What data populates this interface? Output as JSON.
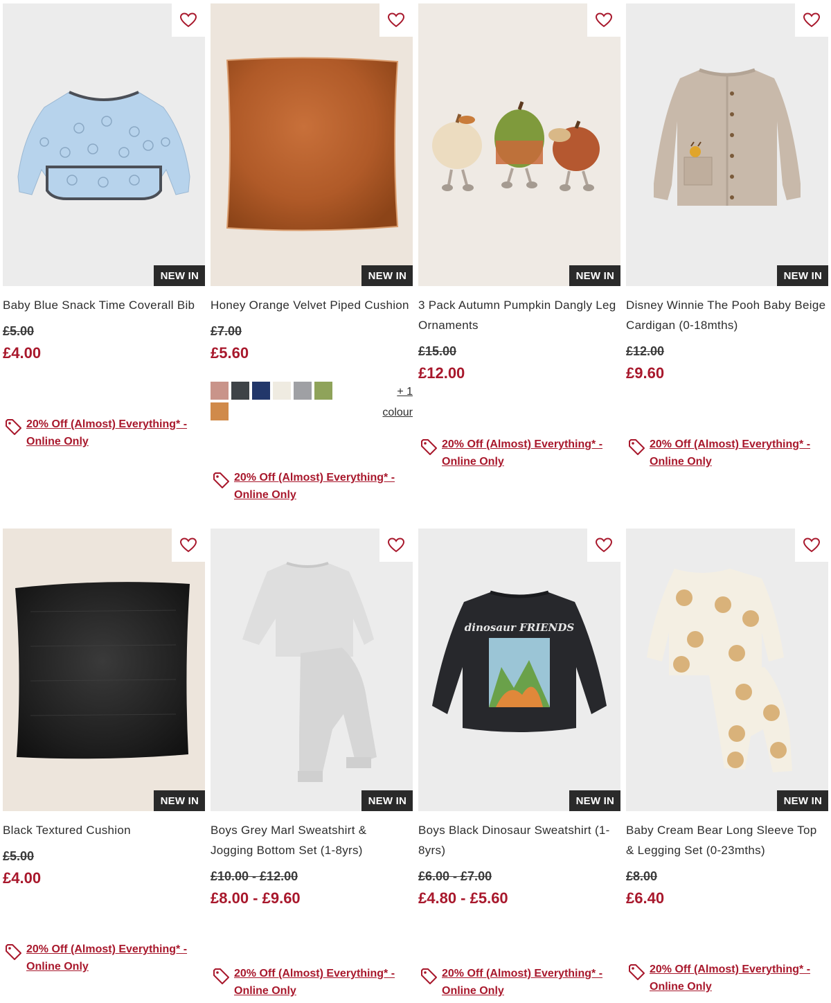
{
  "colors": {
    "sale": "#a8182c",
    "badge": "#2a2a2a"
  },
  "badge_label": "NEW IN",
  "promo_label": "20% Off (Almost) Everything* - Online Only",
  "products": [
    {
      "title": "Baby Blue Snack Time Coverall Bib",
      "was": "£5.00",
      "now": "£4.00",
      "image": "blue-coverall-bib"
    },
    {
      "title": "Honey Orange Velvet Piped Cushion",
      "was": "£7.00",
      "now": "£5.60",
      "image": "orange-velvet-cushion",
      "swatches": [
        "#c9948a",
        "#3e4347",
        "#22376a",
        "#efebe1",
        "#9fa0a4",
        "#8fa35a",
        "#d08a4a"
      ],
      "more_colours": "+ 1 colour"
    },
    {
      "title": "3 Pack Autumn Pumpkin Dangly Leg Ornaments",
      "was": "£15.00",
      "now": "£12.00",
      "image": "pumpkin-ornaments"
    },
    {
      "title": "Disney Winnie The Pooh Baby Beige Cardigan (0-18mths)",
      "was": "£12.00",
      "now": "£9.60",
      "image": "beige-cardigan"
    },
    {
      "title": "Black Textured Cushion",
      "was": "£5.00",
      "now": "£4.00",
      "image": "black-cushion"
    },
    {
      "title": "Boys Grey Marl Sweatshirt & Jogging Bottom Set (1-8yrs)",
      "was": "£10.00 - £12.00",
      "now": "£8.00 - £9.60",
      "image": "grey-marl-set"
    },
    {
      "title": "Boys Black Dinosaur Sweatshirt (1-8yrs)",
      "was": "£6.00 - £7.00",
      "now": "£4.80 - £5.60",
      "image": "black-dinosaur-sweatshirt",
      "print_text": "dinosaur FRIENDS"
    },
    {
      "title": "Baby Cream Bear Long Sleeve Top & Legging Set (0-23mths)",
      "was": "£8.00",
      "now": "£6.40",
      "image": "cream-bear-set"
    }
  ]
}
